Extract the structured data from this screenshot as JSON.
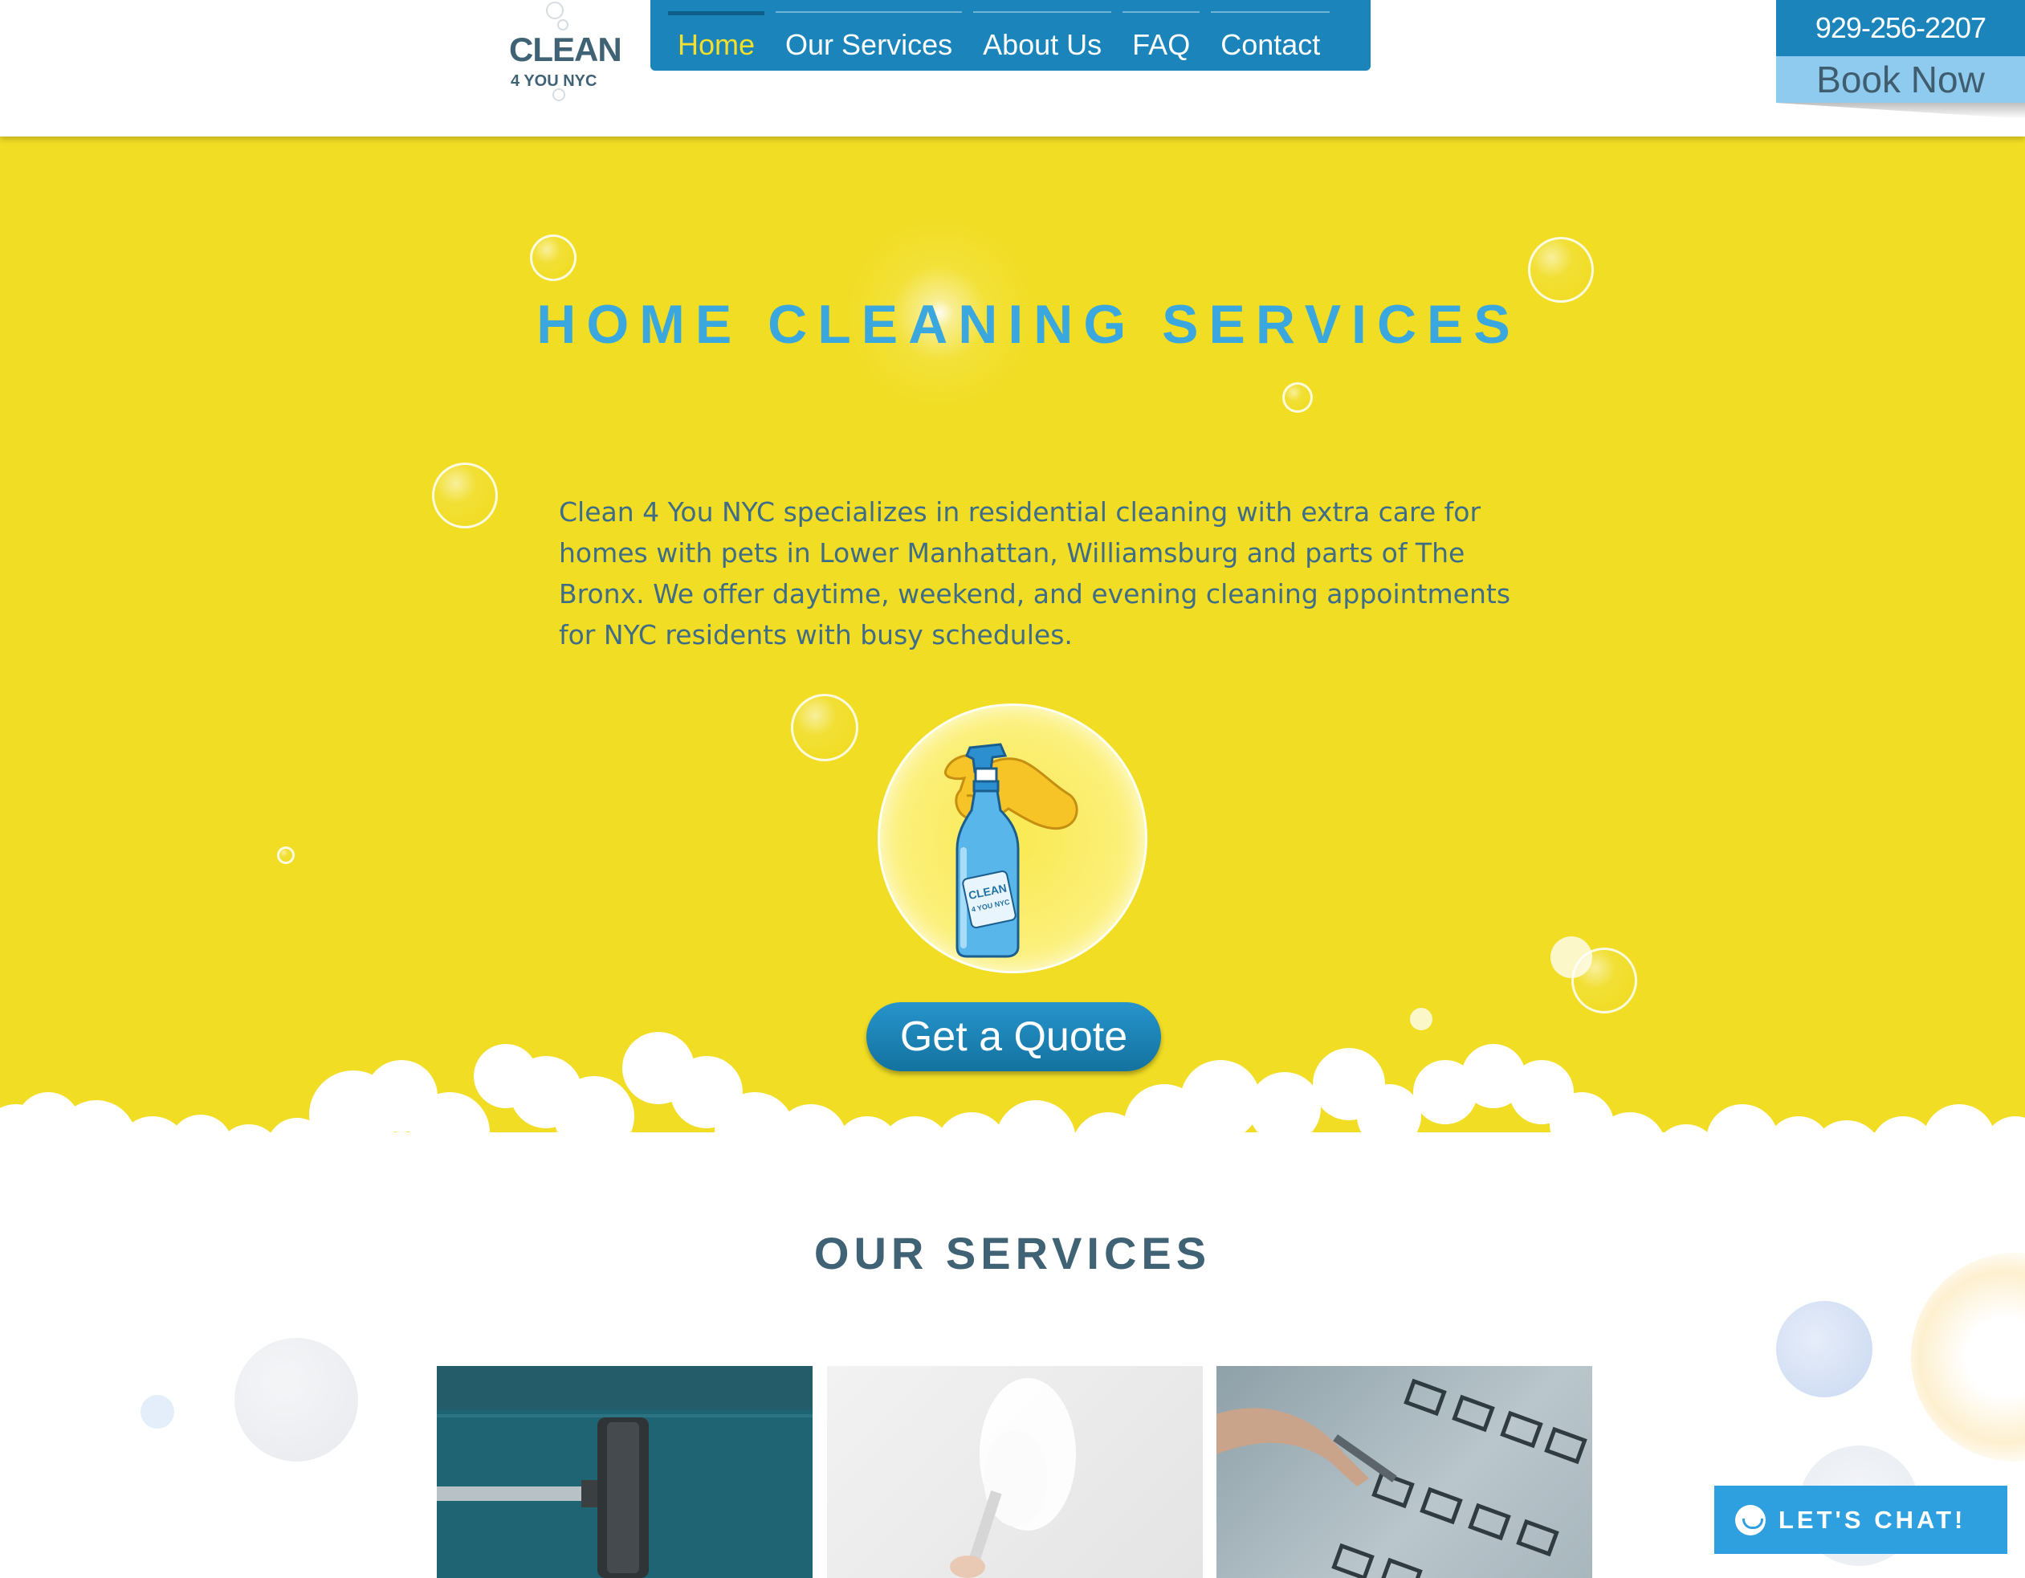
{
  "header": {
    "logo": {
      "line1": "CLEAN",
      "line2": "4 YOU NYC"
    },
    "nav": [
      {
        "label": "Home",
        "active": true
      },
      {
        "label": "Our Services",
        "active": false
      },
      {
        "label": "About Us",
        "active": false
      },
      {
        "label": "FAQ",
        "active": false
      },
      {
        "label": "Contact",
        "active": false
      }
    ],
    "phone": "929-256-2207",
    "book_label": "Book Now"
  },
  "hero": {
    "title": "HOME CLEANING SERVICES",
    "text": "Clean 4 You NYC specializes in residential cleaning with extra care for homes with pets in Lower Manhattan, Williamsburg and parts of The Bronx. We offer daytime, weekend, and evening cleaning appointments for NYC residents with busy schedules.",
    "bottle_label": "CLEAN 4 YOU NYC",
    "quote_label": "Get a Quote"
  },
  "services": {
    "title": "OUR SERVICES"
  },
  "chat": {
    "label": "LET'S CHAT!"
  },
  "colors": {
    "hero_bg": "#f1dd24",
    "brand_blue": "#1a84bb",
    "title_blue": "#3aa8de",
    "text_slate": "#3f6c86",
    "dark_slate": "#3f6274",
    "chat_blue": "#2ea0e0"
  }
}
